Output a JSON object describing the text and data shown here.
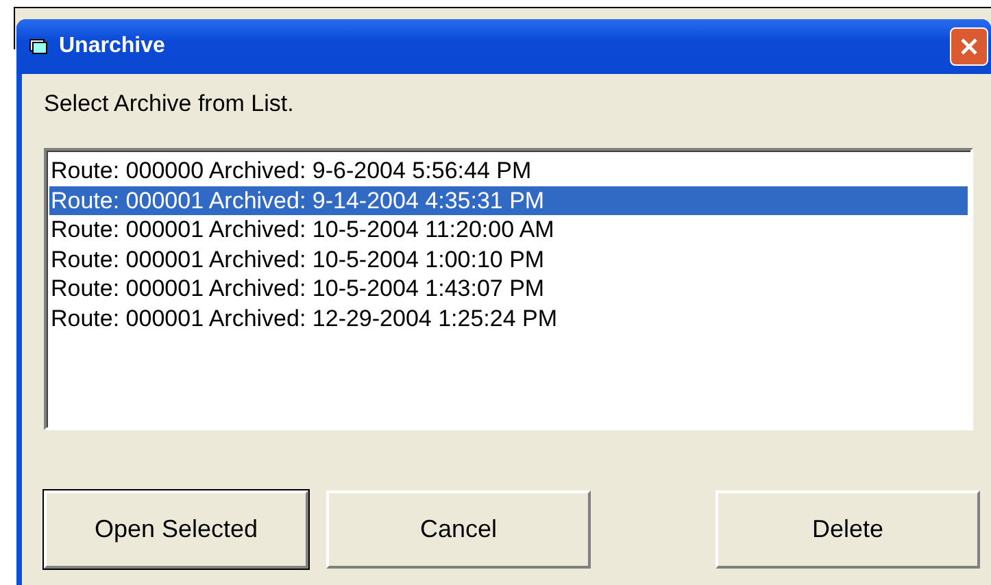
{
  "window": {
    "title": "Unarchive"
  },
  "prompt": "Select Archive from List.",
  "list": [
    {
      "text": "Route: 000000 Archived: 9-6-2004 5:56:44 PM",
      "selected": false
    },
    {
      "text": "Route: 000001 Archived: 9-14-2004 4:35:31 PM",
      "selected": true
    },
    {
      "text": "Route: 000001 Archived: 10-5-2004 11:20:00 AM",
      "selected": false
    },
    {
      "text": "Route: 000001 Archived: 10-5-2004 1:00:10 PM",
      "selected": false
    },
    {
      "text": "Route: 000001 Archived: 10-5-2004 1:43:07 PM",
      "selected": false
    },
    {
      "text": "Route: 000001 Archived: 12-29-2004 1:25:24 PM",
      "selected": false
    }
  ],
  "buttons": [
    {
      "label": "Open Selected",
      "default": true
    },
    {
      "label": "Cancel",
      "default": false
    },
    {
      "label": "Delete",
      "default": false
    }
  ]
}
